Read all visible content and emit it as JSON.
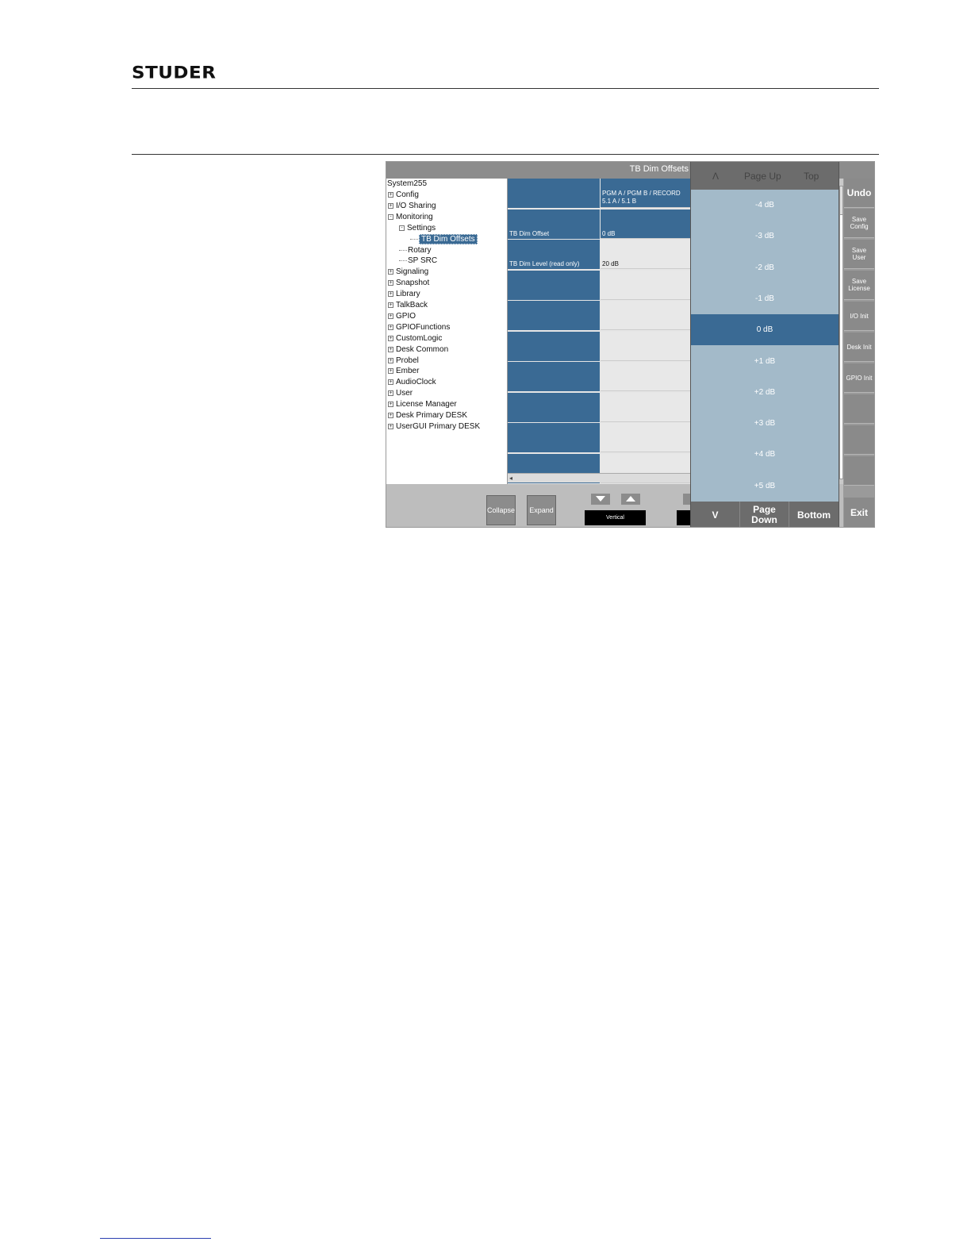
{
  "header": {
    "logo": "STUDER"
  },
  "window": {
    "title": "TB Dim Offsets"
  },
  "tree": {
    "root": "System255",
    "items": [
      {
        "label": "Config",
        "level": 0,
        "expander": "+"
      },
      {
        "label": "I/O Sharing",
        "level": 0,
        "expander": "+"
      },
      {
        "label": "Monitoring",
        "level": 0,
        "expander": "-"
      },
      {
        "label": "Settings",
        "level": 1,
        "expander": "-"
      },
      {
        "label": "TB Dim Offsets",
        "level": 2,
        "expander": "",
        "selected": true
      },
      {
        "label": "Rotary",
        "level": 1,
        "expander": ""
      },
      {
        "label": "SP SRC",
        "level": 1,
        "expander": ""
      },
      {
        "label": "Signaling",
        "level": 0,
        "expander": "+"
      },
      {
        "label": "Snapshot",
        "level": 0,
        "expander": "+"
      },
      {
        "label": "Library",
        "level": 0,
        "expander": "+"
      },
      {
        "label": "TalkBack",
        "level": 0,
        "expander": "+"
      },
      {
        "label": "GPIO",
        "level": 0,
        "expander": "+"
      },
      {
        "label": "GPIOFunctions",
        "level": 0,
        "expander": "+"
      },
      {
        "label": "CustomLogic",
        "level": 0,
        "expander": "+"
      },
      {
        "label": "Desk Common",
        "level": 0,
        "expander": "+"
      },
      {
        "label": "Probel",
        "level": 0,
        "expander": "+"
      },
      {
        "label": "Ember",
        "level": 0,
        "expander": "+"
      },
      {
        "label": "AudioClock",
        "level": 0,
        "expander": "+"
      },
      {
        "label": "User",
        "level": 0,
        "expander": "+"
      },
      {
        "label": "License Manager",
        "level": 0,
        "expander": "+"
      },
      {
        "label": "Desk Primary DESK",
        "level": 0,
        "expander": "+"
      },
      {
        "label": "UserGUI Primary DESK",
        "level": 0,
        "expander": "+"
      }
    ]
  },
  "grid": {
    "rows": [
      {
        "label": "",
        "value_line1": "PGM A / PGM B / RECORD",
        "value_line2": "5.1 A / 5.1 B",
        "highlight": true
      },
      {
        "label": "TB Dim Offset",
        "value_line1": "0 dB",
        "value_line2": "",
        "highlight": true
      },
      {
        "label": "TB Dim Level (read only)",
        "value_line1": "20 dB",
        "value_line2": "",
        "highlight": false
      },
      {
        "label": "",
        "value_line1": "",
        "value_line2": "",
        "highlight": false
      },
      {
        "label": "",
        "value_line1": "",
        "value_line2": "",
        "highlight": false
      },
      {
        "label": "",
        "value_line1": "",
        "value_line2": "",
        "highlight": false
      },
      {
        "label": "",
        "value_line1": "",
        "value_line2": "",
        "highlight": false
      },
      {
        "label": "",
        "value_line1": "",
        "value_line2": "",
        "highlight": false
      },
      {
        "label": "",
        "value_line1": "",
        "value_line2": "",
        "highlight": false
      },
      {
        "label": "",
        "value_line1": "",
        "value_line2": "",
        "highlight": false
      }
    ]
  },
  "bottom": {
    "collapse": "Collapse",
    "expand": "Expand",
    "vertical": "Vertical"
  },
  "dropdown": {
    "head_up": "Λ",
    "head_pageup": "Page Up",
    "head_top": "Top",
    "items": [
      "-4 dB",
      "-3 dB",
      "-2 dB",
      "-1 dB",
      "0 dB",
      "+1 dB",
      "+2 dB",
      "+3 dB",
      "+4 dB",
      "+5 dB"
    ],
    "selected_index": 4,
    "foot_down": "V",
    "foot_pagedown_1": "Page",
    "foot_pagedown_2": "Down",
    "foot_bottom": "Bottom"
  },
  "side": {
    "undo": "Undo",
    "save_config_1": "Save",
    "save_config_2": "Config",
    "save_user_1": "Save",
    "save_user_2": "User",
    "save_license_1": "Save",
    "save_license_2": "License",
    "io_init": "I/O Init",
    "desk_init": "Desk Init",
    "gpio_init": "GPIO Init",
    "exit": "Exit"
  }
}
